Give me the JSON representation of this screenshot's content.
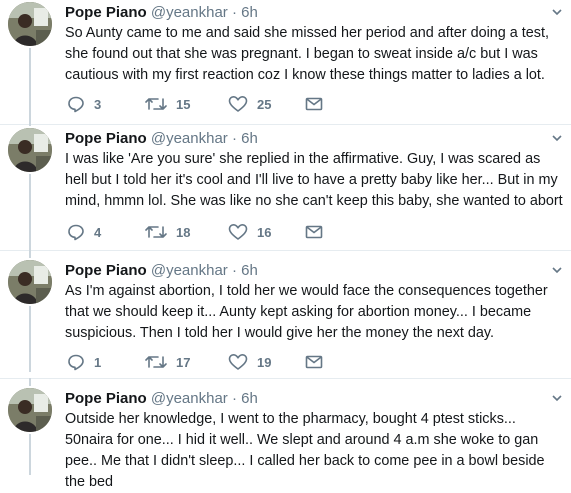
{
  "tweets": [
    {
      "name": "Pope Piano",
      "handle": "@yeankhar",
      "sep": "·",
      "time": "6h",
      "text": "So Aunty came to me and said she missed her period and after doing a test, she found out that she was pregnant. I began to sweat inside a/c but I was cautious with my first reaction coz I know these things matter to ladies a lot.",
      "replies": "3",
      "retweets": "15",
      "likes": "25"
    },
    {
      "name": "Pope Piano",
      "handle": "@yeankhar",
      "sep": "·",
      "time": "6h",
      "text": "I was like 'Are you sure' she replied in the affirmative. Guy, I was scared as hell but I told her it's cool and I'll live to have a pretty baby like her... But in my mind, hmmn lol. She was like no she can't keep this baby, she wanted to abort",
      "replies": "4",
      "retweets": "18",
      "likes": "16"
    },
    {
      "name": "Pope Piano",
      "handle": "@yeankhar",
      "sep": "·",
      "time": "6h",
      "text": "As I'm against abortion, I told her we would face the consequences together that we should keep it... Aunty kept asking for abortion money... I became suspicious. Then I told her I would give her the money the next day.",
      "replies": "1",
      "retweets": "17",
      "likes": "19"
    },
    {
      "name": "Pope Piano",
      "handle": "@yeankhar",
      "sep": "·",
      "time": "6h",
      "text": "Outside her knowledge, I went to the pharmacy, bought 4 ptest sticks... 50naira for one... I hid it well.. We slept and around 4 a.m she woke to gan pee.. Me that I didn't sleep... I called her back to come pee in a bowl beside the bed"
    }
  ],
  "icons": {
    "reply": "reply-icon",
    "retweet": "retweet-icon",
    "like": "heart-icon",
    "dm": "envelope-icon",
    "menu": "chevron-down-icon"
  },
  "colors": {
    "rail": "#ccd6dd",
    "icon": "#657786",
    "text": "#14171a",
    "divider": "#e6ecf0"
  }
}
